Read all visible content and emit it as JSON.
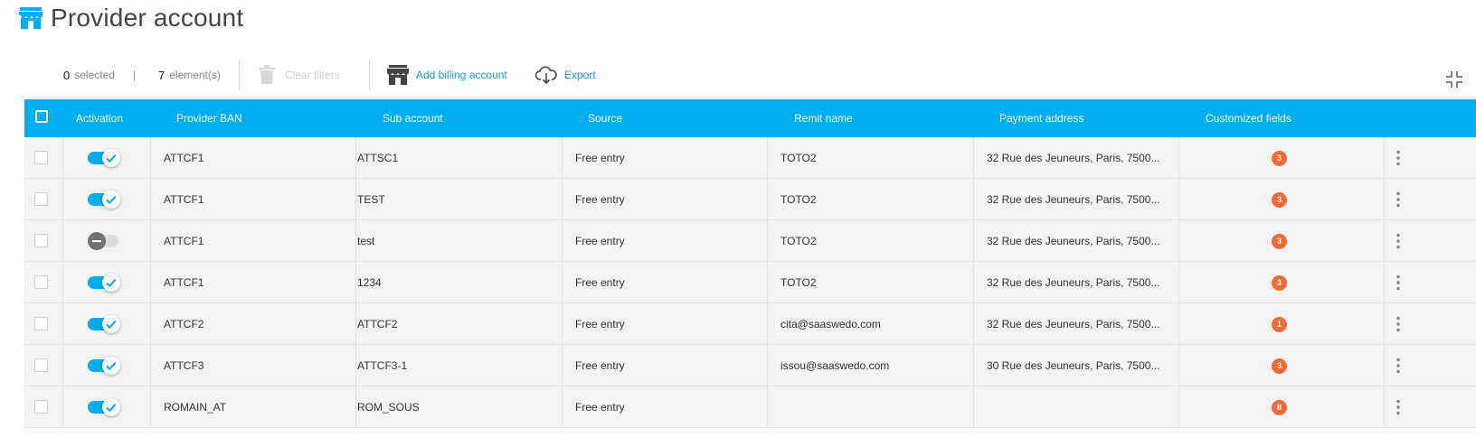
{
  "header": {
    "title": "Provider account",
    "icon": "store-icon"
  },
  "toolbar": {
    "selected_count": "0",
    "selected_label": "selected",
    "separator": "|",
    "elements_count": "7",
    "elements_label": "element(s)",
    "clear_filters_label": "Clear filters",
    "add_billing_label": "Add billing account",
    "export_label": "Export"
  },
  "colors": {
    "accent": "#00aeef",
    "badge": "#f26a35",
    "link": "#1aa3d9"
  },
  "table": {
    "headers": {
      "activation": "Activation",
      "provider_ban": "Provider BAN",
      "sub_account": "Sub account",
      "source": "Source",
      "remit_name": "Remit name",
      "payment_address": "Payment address",
      "customized_fields": "Customized fields"
    },
    "rows": [
      {
        "active": true,
        "provider_ban": "ATTCF1",
        "sub_account": "ATTSC1",
        "source": "Free entry",
        "remit_name": "TOTO2",
        "payment_address": "32 Rue des Jeuneurs, Paris, 7500...",
        "customized_fields": "3"
      },
      {
        "active": true,
        "provider_ban": "ATTCF1",
        "sub_account": "TEST",
        "source": "Free entry",
        "remit_name": "TOTO2",
        "payment_address": "32 Rue des Jeuneurs, Paris, 7500...",
        "customized_fields": "3"
      },
      {
        "active": false,
        "provider_ban": "ATTCF1",
        "sub_account": "test",
        "source": "Free entry",
        "remit_name": "TOTO2",
        "payment_address": "32 Rue des Jeuneurs, Paris, 7500...",
        "customized_fields": "3"
      },
      {
        "active": true,
        "provider_ban": "ATTCF1",
        "sub_account": "1234",
        "source": "Free entry",
        "remit_name": "TOTO2",
        "payment_address": "32 Rue des Jeuneurs, Paris, 7500...",
        "customized_fields": "3"
      },
      {
        "active": true,
        "provider_ban": "ATTCF2",
        "sub_account": "ATTCF2",
        "source": "Free entry",
        "remit_name": "cita@saaswedo.com",
        "payment_address": "32 Rue des Jeuneurs, Paris, 7500...",
        "customized_fields": "1"
      },
      {
        "active": true,
        "provider_ban": "ATTCF3",
        "sub_account": "ATTCF3-1",
        "source": "Free entry",
        "remit_name": "issou@saaswedo.com",
        "payment_address": "30 Rue des Jeuneurs, Paris, 7500...",
        "customized_fields": "3"
      },
      {
        "active": true,
        "provider_ban": "ROMAIN_AT",
        "sub_account": "ROM_SOUS",
        "source": "Free entry",
        "remit_name": "",
        "payment_address": "",
        "customized_fields": "8"
      }
    ]
  }
}
